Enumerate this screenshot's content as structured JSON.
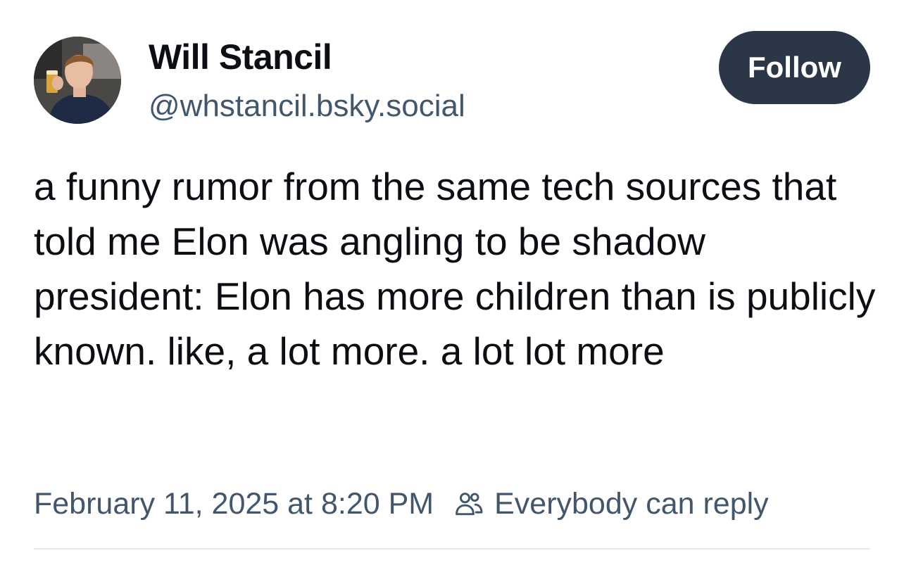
{
  "author": {
    "display_name": "Will Stancil",
    "handle": "@whstancil.bsky.social",
    "avatar_icon": "profile-photo"
  },
  "follow_button": {
    "label": "Follow",
    "background": "#2b3746"
  },
  "post": {
    "text": "a funny rumor from the same tech sources that told me Elon was angling to be shadow president: Elon has more children than is publicly known. like, a lot more. a lot lot more"
  },
  "meta": {
    "timestamp": "February 11, 2025 at 8:20 PM",
    "reply_icon": "people-icon",
    "reply_setting": "Everybody can reply"
  },
  "colors": {
    "text": "#0b0f14",
    "secondary": "#42576c",
    "divider": "#e5e8eb"
  }
}
